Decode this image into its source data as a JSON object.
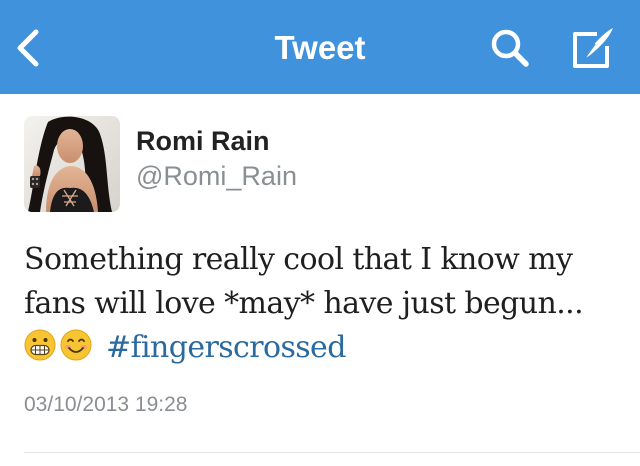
{
  "navbar": {
    "title": "Tweet",
    "back_icon": "chevron-left-icon",
    "search_icon": "search-icon",
    "compose_icon": "compose-icon",
    "background_color": "#3f92db"
  },
  "tweet": {
    "author": {
      "display_name": "Romi Rain",
      "handle": "@Romi_Rain"
    },
    "text_prefix": "Something really cool that I know my fans will love *may* have just begun... ",
    "emojis": [
      "grimacing-face-emoji",
      "smiling-face-emoji"
    ],
    "hashtag": "#fingerscrossed",
    "hashtag_color": "#2b6a9f",
    "timestamp": "03/10/2013 19:28"
  }
}
